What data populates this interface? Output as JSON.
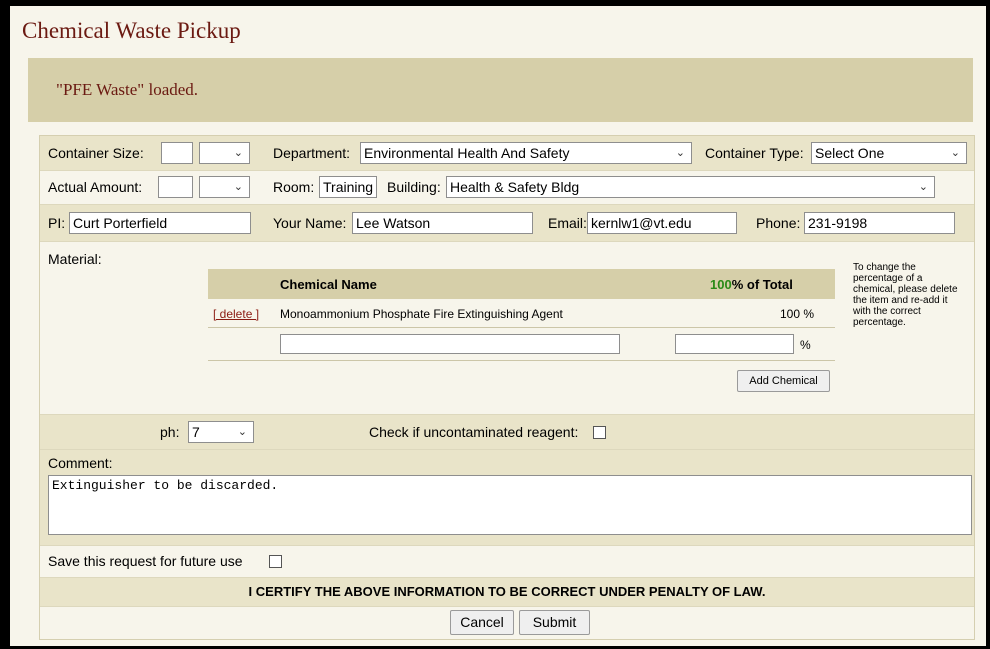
{
  "page": {
    "title": "Chemical Waste Pickup",
    "message": "\"PFE Waste\" loaded."
  },
  "form": {
    "container_size": {
      "label": "Container Size:",
      "value": "",
      "unit": ""
    },
    "department": {
      "label": "Department:",
      "value": "Environmental Health And Safety"
    },
    "container_type": {
      "label": "Container Type:",
      "value": "Select One"
    },
    "actual_amount": {
      "label": "Actual Amount:",
      "value": "",
      "unit": ""
    },
    "room": {
      "label": "Room:",
      "value": "Training"
    },
    "building": {
      "label": "Building:",
      "value": "Health & Safety Bldg"
    },
    "pi": {
      "label": "PI:",
      "value": "Curt Porterfield"
    },
    "your_name": {
      "label": "Your Name:",
      "value": "Lee Watson"
    },
    "email": {
      "label": "Email:",
      "value": "kernlw1@vt.edu"
    },
    "phone": {
      "label": "Phone:",
      "value": "231-9198"
    },
    "material": {
      "label": "Material:",
      "col_name": "Chemical Name",
      "pct_total": "100",
      "pct_total_suffix": "% of Total",
      "rows": [
        {
          "action": "[ delete ]",
          "name": "Monoammonium Phosphate Fire Extinguishing Agent",
          "percent": "100 %"
        }
      ],
      "new_name": "",
      "new_pct": "",
      "pct_sign": "%",
      "add_button": "Add Chemical",
      "help": "To change the percentage of a chemical, please delete the item and re-add it with the correct percentage."
    },
    "ph": {
      "label": "ph:",
      "value": "7"
    },
    "uncontaminated": {
      "label": "Check if uncontaminated reagent:",
      "checked": false
    },
    "comment": {
      "label": "Comment:",
      "value": "Extinguisher to be discarded."
    },
    "save_future": {
      "label": "Save this request for future use",
      "checked": false
    },
    "certify": "I CERTIFY THE ABOVE INFORMATION TO BE CORRECT UNDER PENALTY OF LAW.",
    "cancel_button": "Cancel",
    "submit_button": "Submit"
  }
}
